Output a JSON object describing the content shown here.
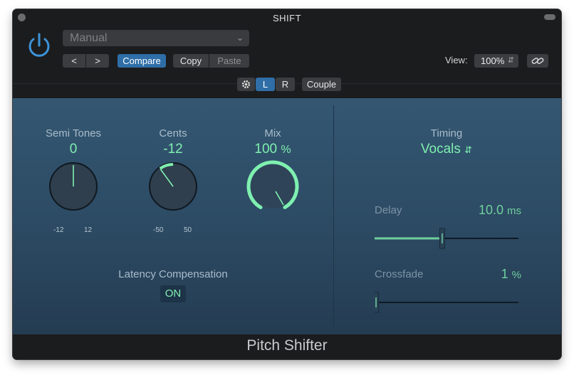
{
  "window": {
    "title": "SHIFT"
  },
  "header": {
    "preset": "Manual",
    "nav_prev": "<",
    "nav_next": ">",
    "compare_label": "Compare",
    "copy_label": "Copy",
    "paste_label": "Paste",
    "view_label": "View:",
    "view_zoom": "100%",
    "link_icon": "link-icon"
  },
  "channel_bar": {
    "settings_icon": "gear-icon",
    "left_label": "L",
    "right_label": "R",
    "couple_label": "Couple"
  },
  "controls": {
    "semi_tones": {
      "label": "Semi Tones",
      "value": "0",
      "min_label": "-12",
      "max_label": "12",
      "min": -12,
      "max": 12,
      "current": 0
    },
    "cents": {
      "label": "Cents",
      "value": "-12",
      "min_label": "-50",
      "max_label": "50",
      "min": -50,
      "max": 50,
      "current": -12
    },
    "mix": {
      "label": "Mix",
      "value": "100",
      "unit": "%",
      "current_percent": 100
    },
    "latency": {
      "label": "Latency Compensation",
      "value": "ON"
    },
    "timing": {
      "label": "Timing",
      "value": "Vocals"
    },
    "delay": {
      "label": "Delay",
      "value": "10.0",
      "unit": "ms",
      "fraction": 0.47
    },
    "crossfade": {
      "label": "Crossfade",
      "value": "1",
      "unit": "%",
      "fraction": 0.01
    }
  },
  "footer": {
    "plugin_name": "Pitch Shifter"
  },
  "colors": {
    "accent": "#7ff0b0",
    "compare_blue": "#2f6ea7",
    "panel_top": "#345772",
    "panel_bottom": "#243c52"
  }
}
